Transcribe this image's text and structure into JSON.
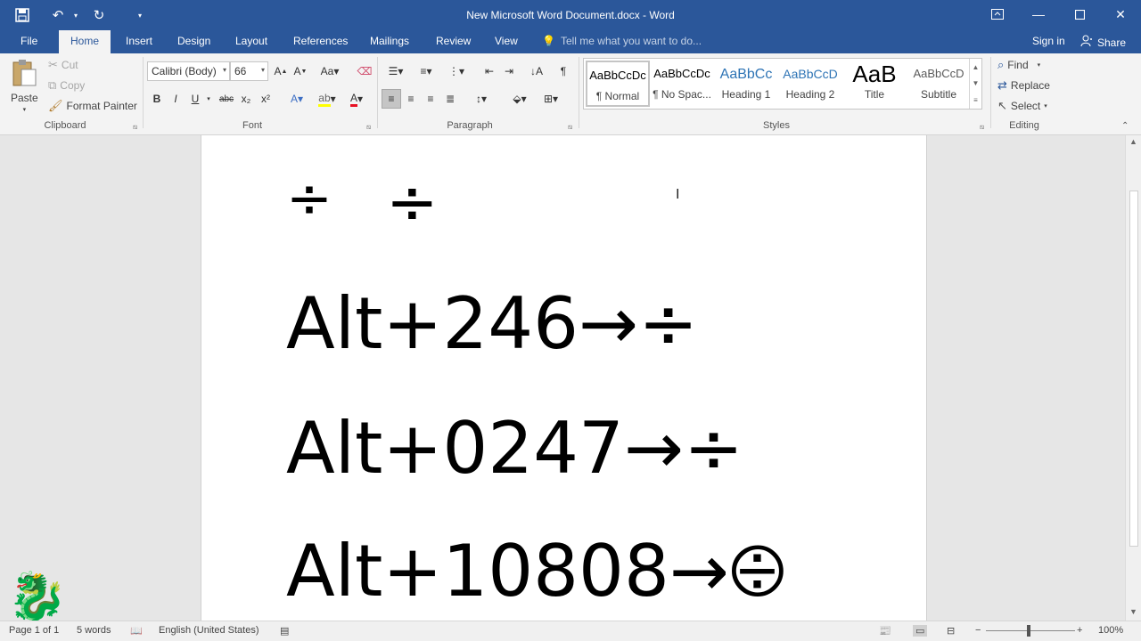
{
  "window": {
    "title": "New Microsoft Word Document.docx - Word",
    "controls": [
      "ribbon-display-icon",
      "minimize-icon",
      "maximize-icon",
      "close-icon"
    ]
  },
  "qat": {
    "icons": [
      "save-icon",
      "undo-icon",
      "redo-icon",
      "customize-icon"
    ]
  },
  "tabs": [
    {
      "label": "File"
    },
    {
      "label": "Home"
    },
    {
      "label": "Insert"
    },
    {
      "label": "Design"
    },
    {
      "label": "Layout"
    },
    {
      "label": "References"
    },
    {
      "label": "Mailings"
    },
    {
      "label": "Review"
    },
    {
      "label": "View"
    }
  ],
  "tellme": {
    "text": "Tell me what you want to do..."
  },
  "account": {
    "signin": "Sign in",
    "share": "Share"
  },
  "clipboard": {
    "label": "Clipboard",
    "paste": "Paste",
    "cut": "Cut",
    "copy": "Copy",
    "format_painter": "Format Painter"
  },
  "font": {
    "label": "Font",
    "family": "Calibri (Body)",
    "size": "66",
    "buttons": [
      "B",
      "I",
      "U",
      "abc",
      "x₂",
      "x²"
    ]
  },
  "paragraph": {
    "label": "Paragraph"
  },
  "styles": {
    "label": "Styles",
    "items": [
      {
        "preview": "AaBbCcDc",
        "name": "¶ Normal"
      },
      {
        "preview": "AaBbCcDc",
        "name": "¶ No Spac..."
      },
      {
        "preview": "AaBbCc",
        "name": "Heading 1"
      },
      {
        "preview": "AaBbCcD",
        "name": "Heading 2"
      },
      {
        "preview": "AaB",
        "name": "Title"
      },
      {
        "preview": "AaBbCcD",
        "name": "Subtitle"
      }
    ]
  },
  "editing": {
    "label": "Editing",
    "find": "Find",
    "replace": "Replace",
    "select": "Select"
  },
  "document": {
    "symbols": [
      "÷",
      "÷"
    ],
    "lines": [
      "Alt+246→÷",
      "Alt+0247→÷",
      "Alt+10808→⨸"
    ]
  },
  "status": {
    "page": "Page 1 of 1",
    "words": "5 words",
    "language": "English (United States)",
    "zoom": "100%",
    "zoom_level": 100
  }
}
